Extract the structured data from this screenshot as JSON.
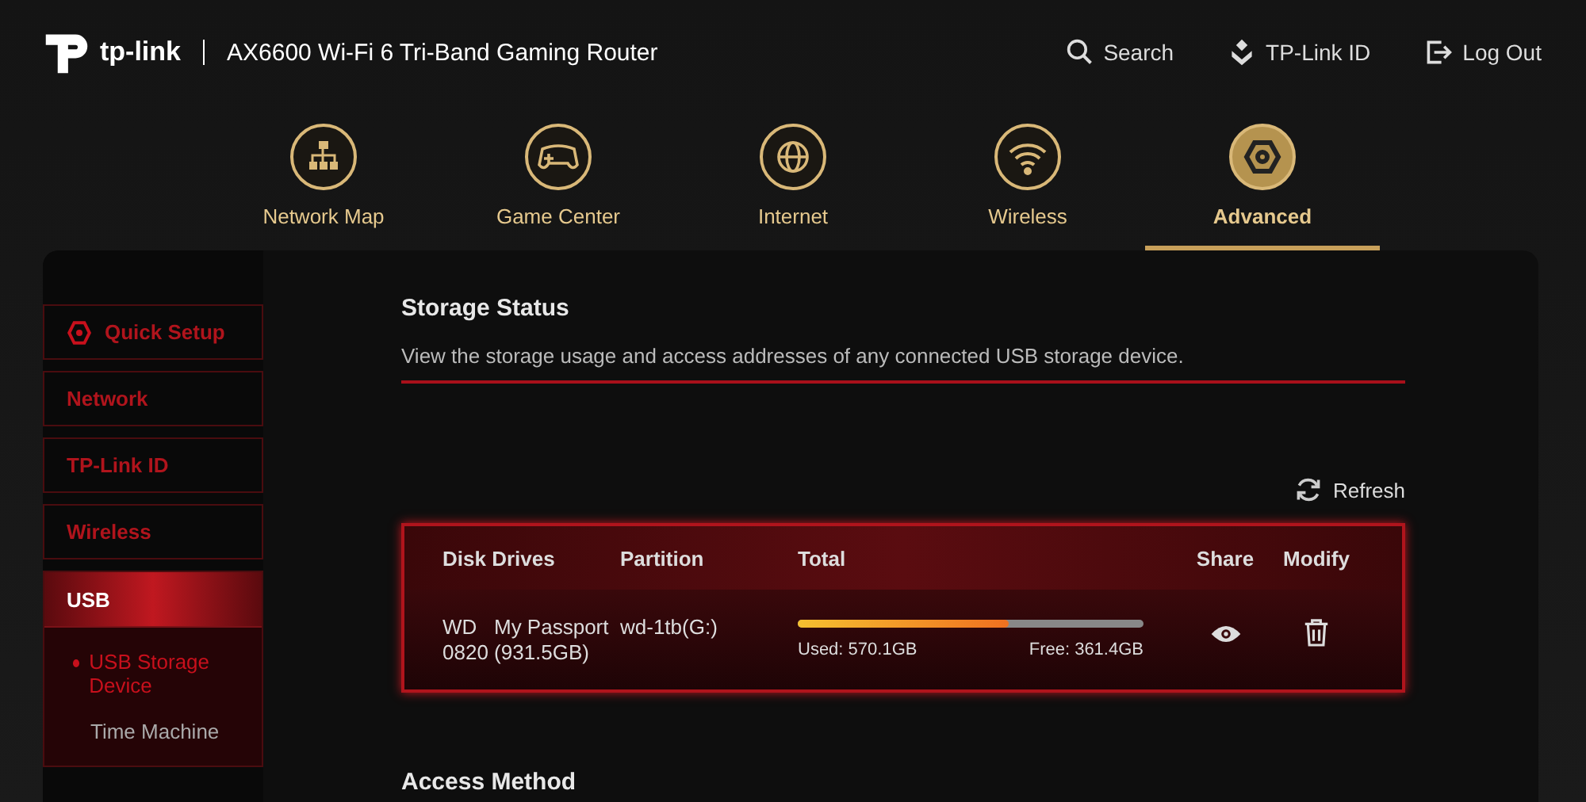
{
  "header": {
    "brand": "tp-link",
    "model": "AX6600 Wi-Fi 6 Tri-Band Gaming Router",
    "links": [
      {
        "label": "Search"
      },
      {
        "label": "TP-Link ID"
      },
      {
        "label": "Log Out"
      }
    ]
  },
  "nav_tabs": [
    {
      "label": "Network Map",
      "selected": false
    },
    {
      "label": "Game Center",
      "selected": false
    },
    {
      "label": "Internet",
      "selected": false
    },
    {
      "label": "Wireless",
      "selected": false
    },
    {
      "label": "Advanced",
      "selected": true
    }
  ],
  "sidebar": {
    "items": [
      {
        "label": "Quick Setup",
        "kind": "setup",
        "selected": false,
        "expanded": false
      },
      {
        "label": "Network",
        "kind": "menu",
        "selected": false,
        "expanded": false
      },
      {
        "label": "TP-Link ID",
        "kind": "menu",
        "selected": false,
        "expanded": false
      },
      {
        "label": "Wireless",
        "kind": "menu",
        "selected": false,
        "expanded": false
      },
      {
        "label": "USB",
        "kind": "group",
        "selected": true,
        "expanded": true,
        "children": [
          {
            "label": "USB Storage Device",
            "selected": true
          },
          {
            "label": "Time Machine",
            "selected": false
          }
        ]
      }
    ]
  },
  "storage_status": {
    "title": "Storage Status",
    "description": "View the storage usage and access addresses of any connected USB storage device.",
    "refresh": "Refresh",
    "table": {
      "columns": [
        "Disk Drives",
        "Partition",
        "Total",
        "Share",
        "Modify"
      ],
      "rows": [
        {
          "disk": "WD   My Passport 0820 (931.5GB)",
          "partition": "wd-1tb(G:)",
          "level": 0.612,
          "used": "Used: 570.1GB",
          "free": "Free: 361.4GB"
        }
      ]
    }
  },
  "access_method": {
    "title": "Access Method"
  }
}
